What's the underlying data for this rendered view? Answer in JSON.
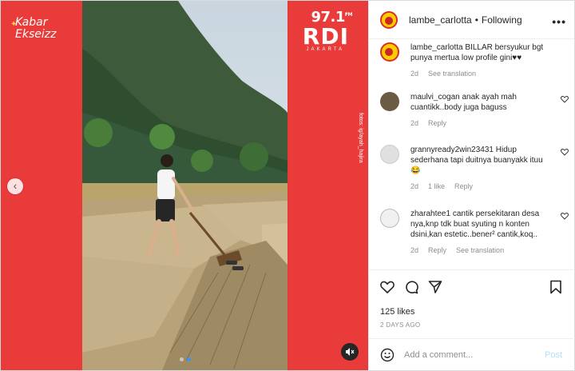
{
  "media": {
    "left_brand": "Kabar Ekseizz",
    "right_brand_freq": "97.1",
    "right_brand_freq_unit": "FM",
    "right_brand_name": "RDI",
    "right_brand_sub": "JAKARTA",
    "credit": "fotos: ig/ayah_hajira",
    "colors": {
      "brand_red": "#ea3b3b",
      "dot_active": "#3897f0"
    },
    "slide_dots": 2,
    "active_dot": 1
  },
  "header": {
    "handle": "lambe_carlotta",
    "separator": "•",
    "follow_state": "Following",
    "more": "•••"
  },
  "caption": {
    "user": "lambe_carlotta",
    "text": "BILLAR bersyukur bgt punya mertua low profile gini♥♥",
    "time": "2d",
    "see_translation": "See translation"
  },
  "comments": [
    {
      "user": "maulvi_cogan",
      "text": "anak ayah mah cuantikk..body juga baguss",
      "time": "2d",
      "reply": "Reply",
      "likes": ""
    },
    {
      "user": "grannyready2win23431",
      "text": "Hidup sederhana tapi duitnya buanyakk ituu 😂",
      "time": "2d",
      "likes": "1 like",
      "reply": "Reply"
    },
    {
      "user": "zharahtee1",
      "text": "cantik persekitaran desa nya,knp tdk buat syuting n konten dsini,kan estetic..bener² cantik,koq..",
      "time": "2d",
      "reply": "Reply",
      "see_translation": "See translation"
    }
  ],
  "actions": {
    "likes": "125 likes",
    "date": "2 DAYS AGO"
  },
  "add_comment": {
    "placeholder": "Add a comment...",
    "post": "Post"
  }
}
